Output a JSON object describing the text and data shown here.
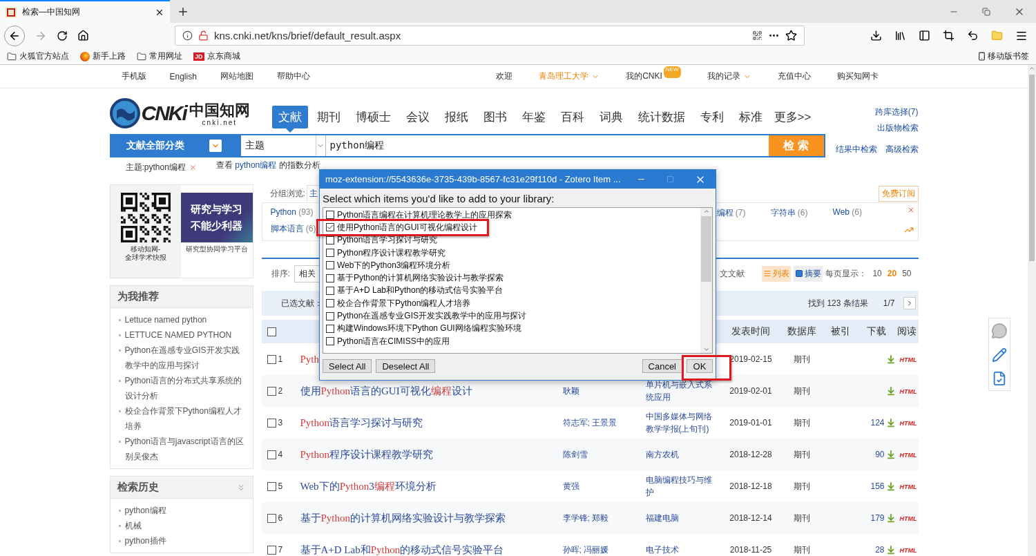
{
  "browser": {
    "tab_title": "检索—中国知网",
    "url": "kns.cnki.net/kns/brief/default_result.aspx",
    "bookmarks": [
      {
        "label": "火狐官方站点",
        "kind": "folder"
      },
      {
        "label": "新手上路",
        "kind": "firefox"
      },
      {
        "label": "常用网址",
        "kind": "folder"
      },
      {
        "label": "京东商城",
        "kind": "jd",
        "icon_text": "JD"
      }
    ],
    "mobile_bookmarks": "移动版书签"
  },
  "topnav": {
    "links": [
      "手机版",
      "English",
      "网站地图",
      "帮助中心"
    ],
    "welcome": "欢迎",
    "institution": "青岛理工大学",
    "my_cnki": "我的CNKI",
    "new_badge": "NEW",
    "my_records": "我的记录",
    "recharge": "充值中心",
    "buy_card": "购买知网卡"
  },
  "header": {
    "logo_mark": "CNKi",
    "logo_name": "中国知网",
    "logo_domain": "cnki.net",
    "tabs": [
      {
        "label": "文献",
        "selected": true
      },
      {
        "label": "期刊",
        "selected": false
      },
      {
        "label": "博硕士",
        "selected": false
      },
      {
        "label": "会议",
        "selected": false
      },
      {
        "label": "报纸",
        "selected": false
      },
      {
        "label": "图书",
        "selected": false
      },
      {
        "label": "年鉴",
        "selected": false
      },
      {
        "label": "百科",
        "selected": false
      },
      {
        "label": "词典",
        "selected": false
      },
      {
        "label": "统计数据",
        "selected": false
      },
      {
        "label": "专利",
        "selected": false
      },
      {
        "label": "标准",
        "selected": false
      }
    ],
    "more": "更多>>",
    "cross_db": "跨库选择(7)",
    "publication_search": "出版物检索",
    "search": {
      "category": "文献全部分类",
      "field": "主题",
      "value": "python编程",
      "button": "检 索"
    },
    "within_results": "结果中检索",
    "advanced": "高级检索"
  },
  "query": {
    "tag": "主题:python编程",
    "analysis_prefix": "查看 ",
    "analysis_keyword": "python编程",
    "analysis_suffix": " 的指数分析"
  },
  "sidebar": {
    "promo": {
      "qr_caption": "移动知网-\n全球学术快报",
      "banner_text": "研究与学习不能少利器",
      "banner_caption": "研究型协同学习平台"
    },
    "recommend": {
      "title": "为我推荐",
      "items": [
        "Lettuce named python",
        "LETTUCE NAMED PYTHON",
        "Python在遥感专业GIS开发实践教学中的应用与探讨",
        "Python语言的分布式共享系统的设计分析",
        "校企合作背景下Python编程人才培养",
        "Python语言与javascript语言的区别吴俊杰"
      ]
    },
    "history": {
      "title": "检索历史",
      "items": [
        "python编程",
        "机械",
        "python插件"
      ]
    }
  },
  "results": {
    "group_label": "分组浏览:",
    "group_tab": "主",
    "subscribe": "免费订阅",
    "group_rows": [
      [
        {
          "label": "Python",
          "count": "(93)"
        },
        {
          "label": "编程",
          "count": "(7)"
        },
        {
          "label": "字符串",
          "count": "(6)"
        },
        {
          "label": "Web",
          "count": "(6)"
        }
      ],
      [
        {
          "label": "脚本语言",
          "count": "(6)"
        }
      ]
    ],
    "sort_label": "排序:",
    "sort_value": "相关",
    "foreign_label": "文文献",
    "views": [
      {
        "label": "列表",
        "kind": "list",
        "selected": true
      },
      {
        "label": "摘要",
        "kind": "abstract",
        "selected": false
      }
    ],
    "per_page_label": "每页显示：",
    "per_page": [
      {
        "label": "10",
        "selected": false
      },
      {
        "label": "20",
        "selected": true
      },
      {
        "label": "50",
        "selected": false
      }
    ],
    "selected_label": "已选文献：",
    "found": "找到 123 条结果",
    "page": "1/7",
    "select_all_checked": false,
    "columns": [
      "发表时间",
      "数据库",
      "被引",
      "下载",
      "阅读"
    ],
    "rows": [
      {
        "index": "1",
        "title": "**Pyth**",
        "date": "2019-02-15",
        "db": "期刊",
        "read": "HTML",
        "checked": false
      },
      {
        "index": "2",
        "title": "使用**Python**语言的GUI可视化**编程**设计",
        "author": "耿颖",
        "source": "单片机与嵌入式系统应用",
        "date": "2019-02-01",
        "db": "期刊",
        "read": "HTML",
        "checked": false
      },
      {
        "index": "3",
        "title": "**Python**语言学习探讨与研究",
        "author": "符志军; 王景景",
        "source": "中国多媒体与网络教学学报(上旬刊)",
        "date": "2019-01-01",
        "db": "期刊",
        "downloads": "124",
        "read": "HTML",
        "checked": false
      },
      {
        "index": "4",
        "title": "**Python**程序设计课程教学研究",
        "author": "陈剑雪",
        "source": "南方农机",
        "date": "2018-12-28",
        "db": "期刊",
        "downloads": "90",
        "read": "HTML",
        "checked": false
      },
      {
        "index": "5",
        "title": "Web下的**Python**3**编程**环境分析",
        "author": "黄强",
        "source": "电脑编程技巧与维护",
        "date": "2018-12-18",
        "db": "期刊",
        "downloads": "156",
        "read": "HTML",
        "checked": false
      },
      {
        "index": "6",
        "title": "基于**Python**的计算机网络实验设计与教学探索",
        "author": "李学锋; 郑毅",
        "source": "福建电脑",
        "date": "2018-12-14",
        "db": "期刊",
        "downloads": "179",
        "read": "HTML",
        "checked": false
      },
      {
        "index": "7",
        "title": "基于A+D Lab和**Python**的移动式信号实验平台",
        "author": "孙晖; 冯丽媛",
        "source": "电子技术",
        "date": "2018-11-25",
        "db": "期刊",
        "downloads": "28",
        "read": "HTML",
        "checked": false
      }
    ]
  },
  "dialog": {
    "title": "moz-extension://5543636e-3735-439b-8567-fc31e29f110d - Zotero Item ...",
    "prompt": "Select which items you'd like to add to your library:",
    "items": [
      {
        "label": "Python语言编程在计算机理论教学上的应用探索",
        "checked": false,
        "highlighted": false
      },
      {
        "label": "使用Python语言的GUI可视化编程设计",
        "checked": true,
        "highlighted": true
      },
      {
        "label": "Python语言学习探讨与研究",
        "checked": false,
        "highlighted": false
      },
      {
        "label": "Python程序设计课程教学研究",
        "checked": false,
        "highlighted": false
      },
      {
        "label": "Web下的Python3编程环境分析",
        "checked": false,
        "highlighted": false
      },
      {
        "label": "基于Python的计算机网络实验设计与教学探索",
        "checked": false,
        "highlighted": false
      },
      {
        "label": "基于A+D Lab和Python的移动式信号实验平台",
        "checked": false,
        "highlighted": false
      },
      {
        "label": "校企合作背景下Python编程人才培养",
        "checked": false,
        "highlighted": false
      },
      {
        "label": "Python在遥感专业GIS开发实践教学中的应用与探讨",
        "checked": false,
        "highlighted": false
      },
      {
        "label": "构建Windows环境下Python GUI网络编程实验环境",
        "checked": false,
        "highlighted": false
      },
      {
        "label": "Python语言在CIMISS中的应用",
        "checked": false,
        "highlighted": false
      }
    ],
    "select_all": "Select All",
    "deselect_all": "Deselect All",
    "cancel": "Cancel",
    "ok": "OK",
    "ok_highlighted": true
  }
}
